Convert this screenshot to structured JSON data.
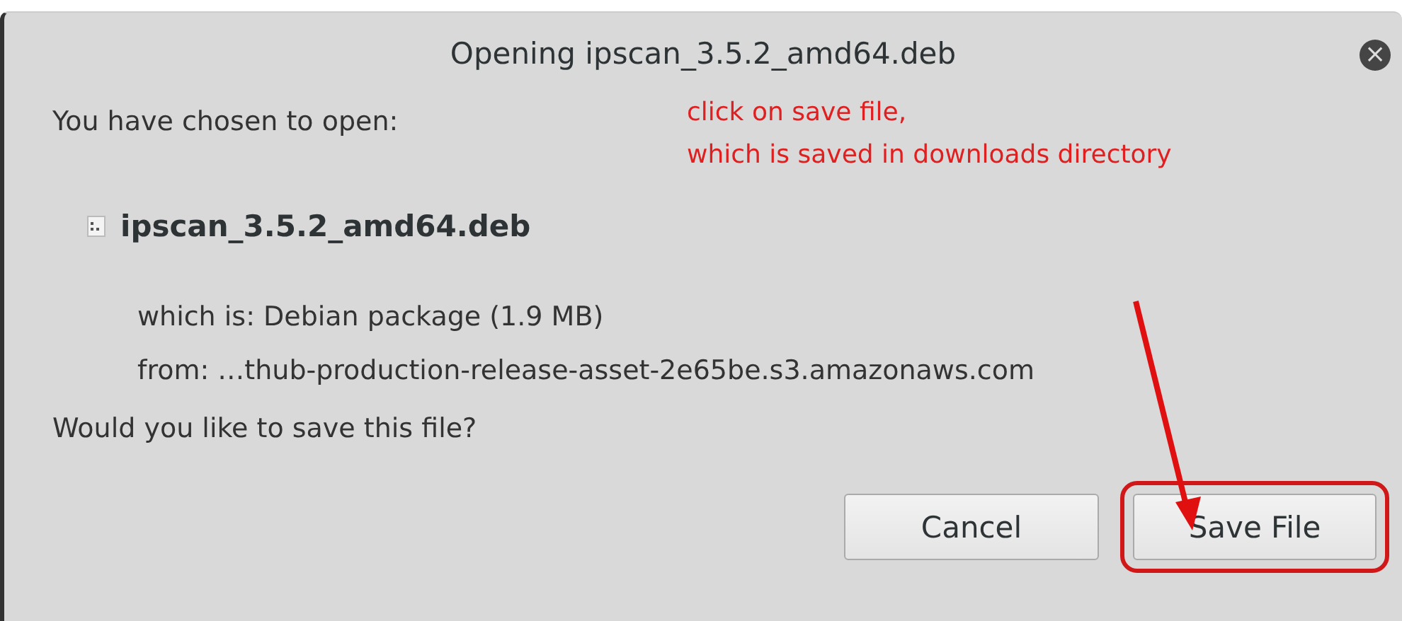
{
  "window": {
    "title": "Opening ipscan_3.5.2_amd64.deb",
    "close_icon": "×"
  },
  "intro": "You have chosen to open:",
  "file": {
    "name": "ipscan_3.5.2_amd64.deb",
    "type_line": "which is: Debian package (1.9 MB)",
    "source_line": "from: …thub-production-release-asset-2e65be.s3.amazonaws.com"
  },
  "question": "Would you like to save this file?",
  "buttons": [
    {
      "label": "Cancel",
      "highlighted": false
    },
    {
      "label": "Save File",
      "highlighted": true
    }
  ],
  "annotation": {
    "lines": [
      "click on save file,",
      "which is saved in downloads directory"
    ]
  }
}
